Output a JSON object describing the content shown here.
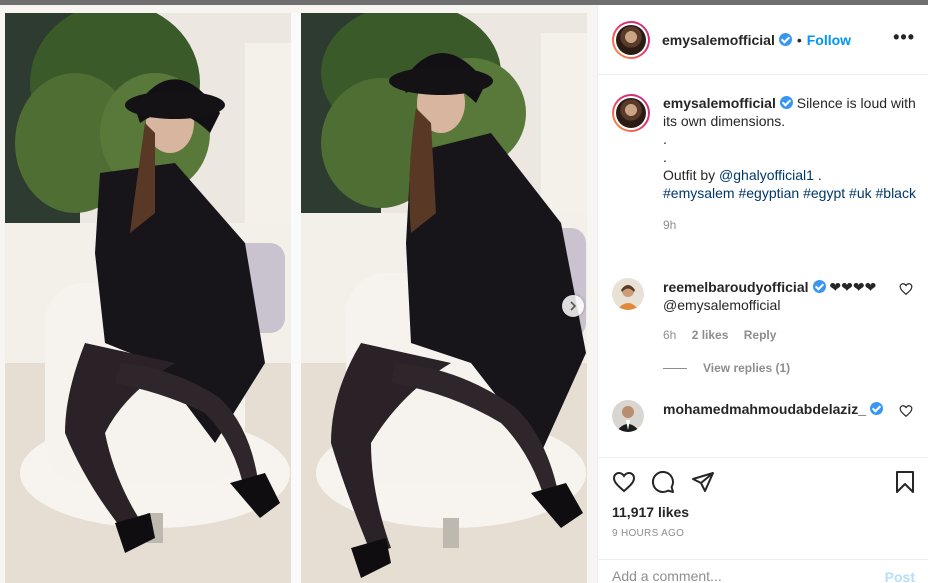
{
  "post": {
    "username": "emysalemofficial",
    "follow_label": "Follow",
    "dot": "•",
    "more_label": "•••"
  },
  "caption": {
    "username": "emysalemofficial",
    "line1": "Silence is loud with its own dimensions.",
    "dot1": ".",
    "dot2": ".",
    "outfit_prefix": "Outfit by",
    "outfit_mention": "@ghalyofficial1",
    "outfit_suffix": " .",
    "hashtags": [
      "#emysalem",
      "#egyptian",
      "#egypt",
      "#uk",
      "#black"
    ],
    "time": "9h"
  },
  "comments": [
    {
      "username": "reemelbaroudyofficial",
      "text": "❤❤❤❤",
      "mention_prefix": "",
      "mention": "@emysalemofficial",
      "time": "6h",
      "likes": "2 likes",
      "reply_label": "Reply",
      "view_replies": "View replies (1)"
    },
    {
      "username": "mohamedmahmoudabdelaziz_",
      "text": ""
    }
  ],
  "actions": {
    "like_icon": "heart-icon",
    "comment_icon": "comment-icon",
    "share_icon": "paper-plane-icon",
    "save_icon": "bookmark-icon"
  },
  "likes_count": "11,917 likes",
  "post_time": "9 HOURS AGO",
  "add_comment": {
    "placeholder": "Add a comment...",
    "post_label": "Post"
  },
  "colors": {
    "link_blue": "#0095f6",
    "hashtag_blue": "#00376b",
    "verified_blue": "#3897f0",
    "muted": "#8e8e8e"
  }
}
